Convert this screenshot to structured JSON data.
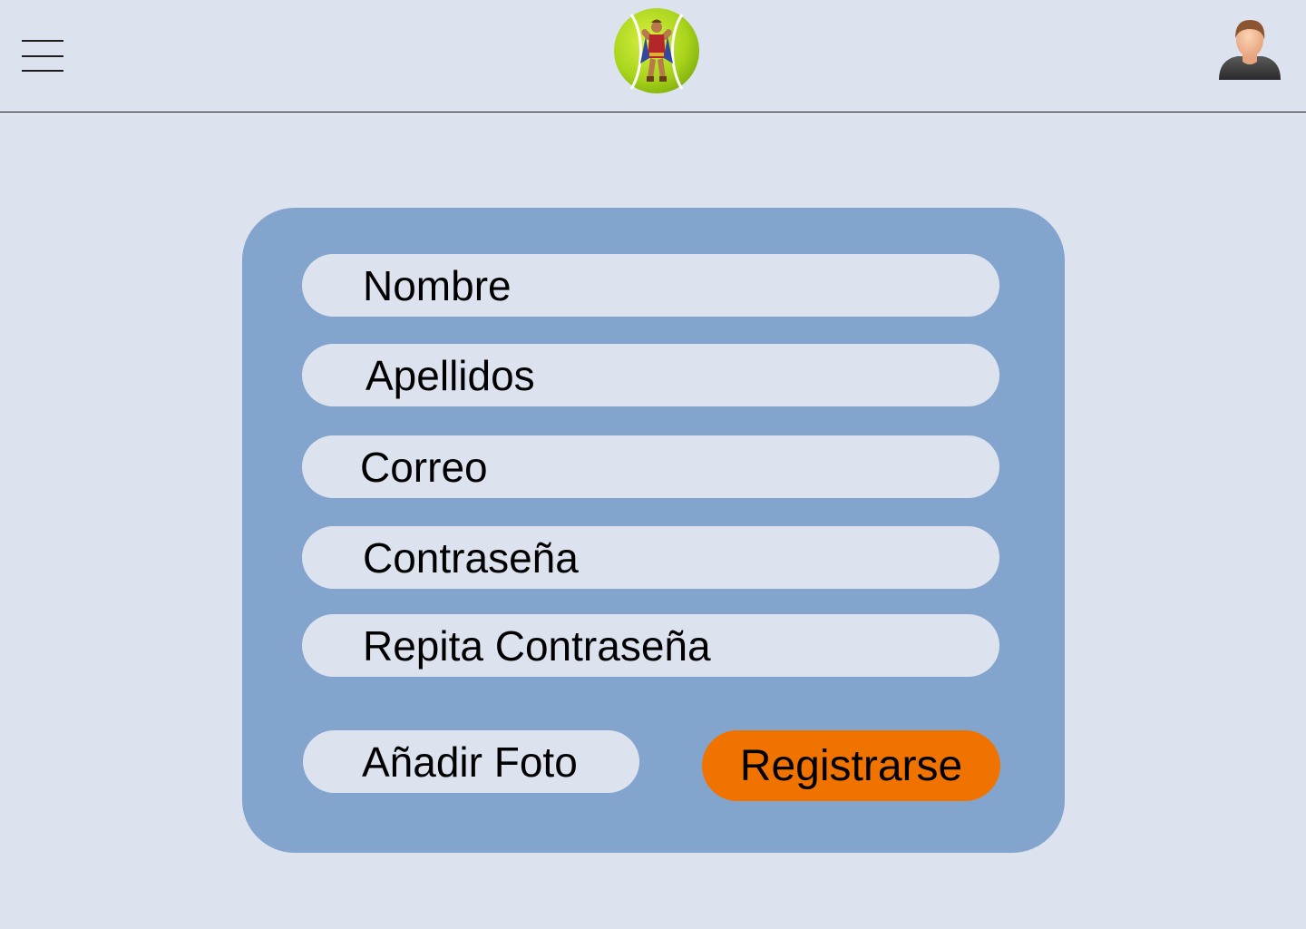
{
  "header": {
    "menu_icon": "hamburger-menu-icon",
    "logo_icon": "tennis-ball-hercules-logo",
    "profile_icon": "user-avatar-icon"
  },
  "form": {
    "fields": [
      {
        "placeholder": "Nombre",
        "type": "text"
      },
      {
        "placeholder": "Apellidos",
        "type": "text"
      },
      {
        "placeholder": "Correo",
        "type": "email"
      },
      {
        "placeholder": "Contraseña",
        "type": "password"
      },
      {
        "placeholder": "Repita Contraseña",
        "type": "password"
      }
    ],
    "add_photo_label": "Añadir Foto",
    "register_label": "Registrarse"
  },
  "colors": {
    "background": "#dce3ef",
    "card": "#82a4cd",
    "accent": "#f07300"
  }
}
